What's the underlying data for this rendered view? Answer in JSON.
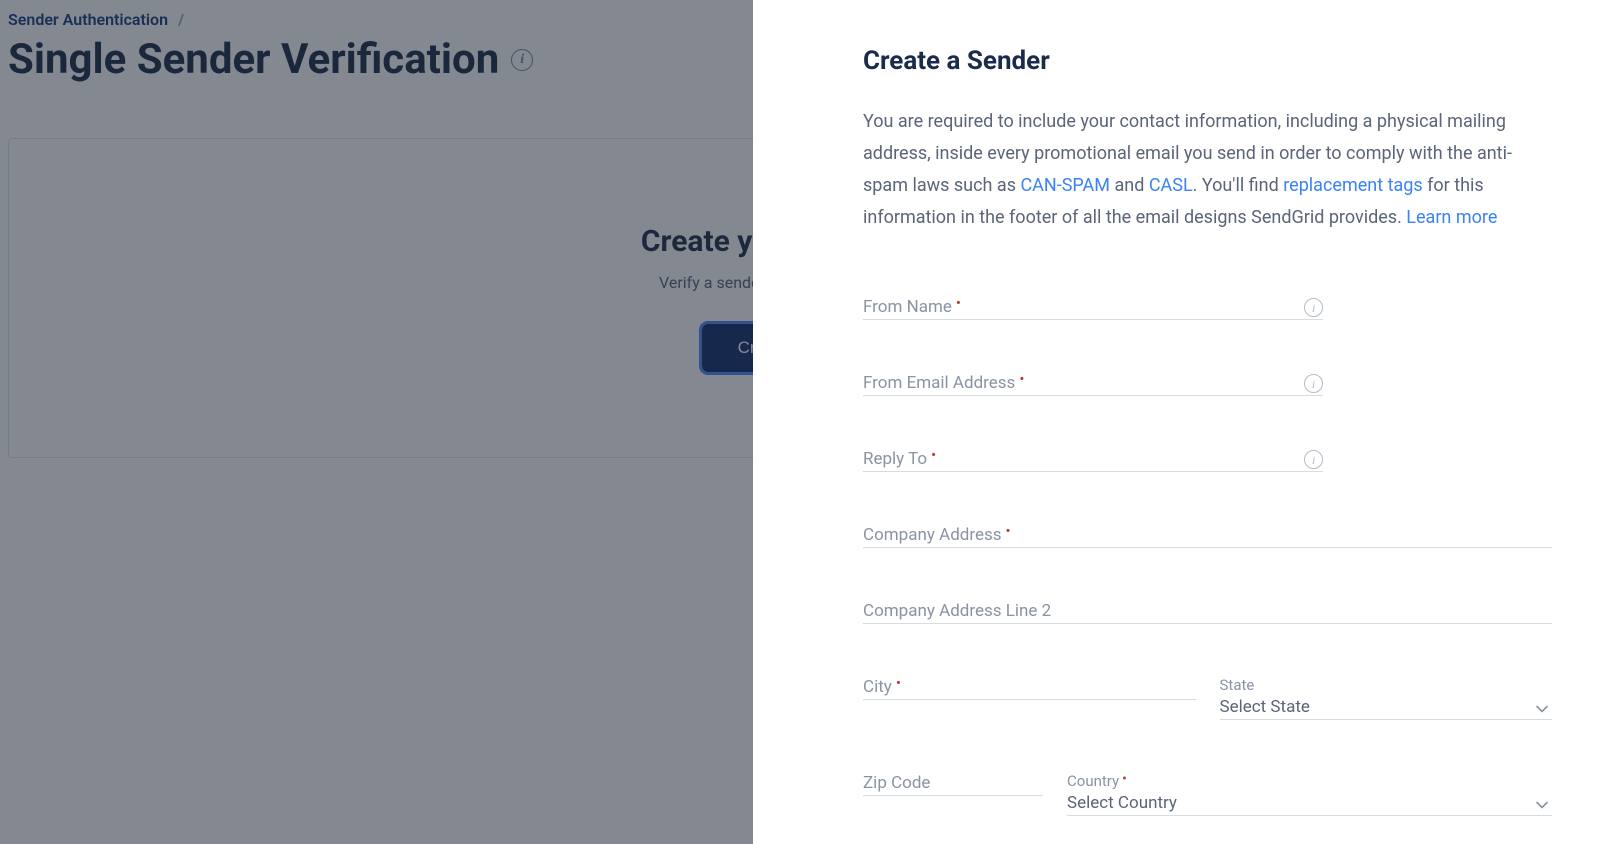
{
  "breadcrumb": {
    "parent": "Sender Authentication",
    "sep": "/"
  },
  "page": {
    "title": "Single Sender Verification"
  },
  "card": {
    "title": "Create your first sender",
    "subtitle": "Verify a sender identity to start sending.",
    "button": "Create a Sender"
  },
  "drawer": {
    "title": "Create a Sender",
    "desc": {
      "part1": "You are required to include your contact information, including a physical mailing address, inside every promotional email you send in order to comply with the anti-spam laws such as ",
      "link1": "CAN-SPAM",
      "mid1": " and ",
      "link2": "CASL",
      "part2": ". You'll find ",
      "link3": "replacement tags",
      "part3": " for this information in the footer of all the email designs SendGrid provides. ",
      "link4": "Learn more"
    },
    "fields": {
      "from_name": "From Name",
      "from_email": "From Email Address",
      "reply_to": "Reply To",
      "company_address": "Company Address",
      "company_address2": "Company Address Line 2",
      "city": "City",
      "state_label": "State",
      "state_value": "Select State",
      "zip": "Zip Code",
      "country_label": "Country",
      "country_value": "Select Country"
    }
  }
}
